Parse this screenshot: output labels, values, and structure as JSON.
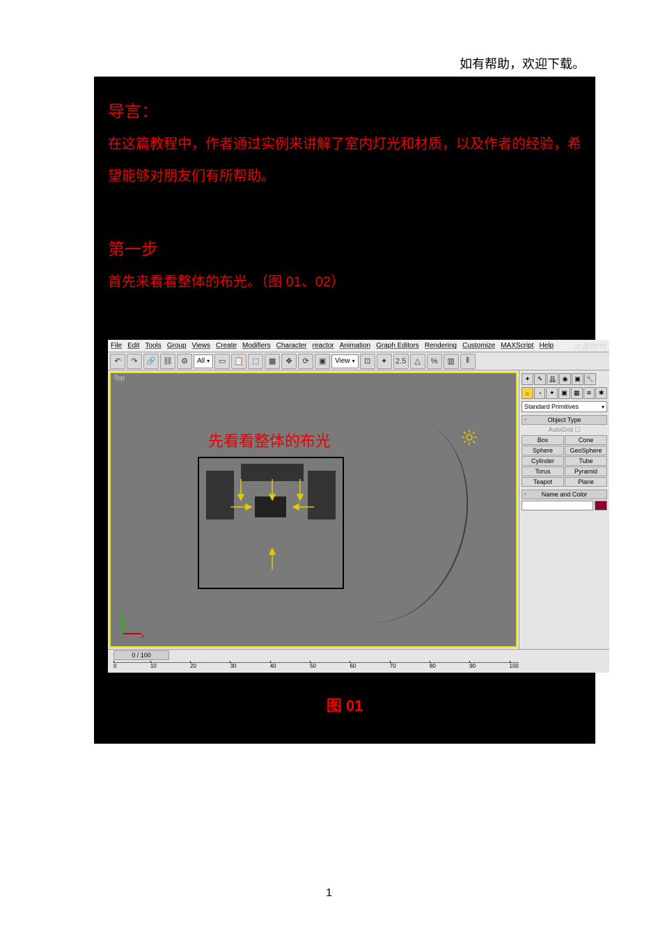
{
  "header": {
    "help_note": "如有帮助，欢迎下载。"
  },
  "article": {
    "intro_label": "导言：",
    "intro_body": "在这篇教程中，作者通过实例来讲解了室内灯光和材质，以及作者的经验，希望能够对朋友们有所帮助。",
    "step1_label": "第一步",
    "step1_body": "首先来看看整体的布光。（图 01、02）",
    "figure_caption": "图 01"
  },
  "screenshot": {
    "menubar": [
      "File",
      "Edit",
      "Tools",
      "Group",
      "Views",
      "Create",
      "Modifiers",
      "Character",
      "reactor",
      "Animation",
      "Graph Editors",
      "Rendering",
      "Customize",
      "MAXScript",
      "Help"
    ],
    "toolbar": {
      "all_label": "All",
      "view_label": "View"
    },
    "viewport": {
      "label": "Top",
      "annotation": "先看看整体的布光"
    },
    "side_panel": {
      "dropdown_selected": "Standard Primitives",
      "object_type_header": "Object Type",
      "autogrid": "AutoGrid",
      "buttons": [
        "Box",
        "Cone",
        "Sphere",
        "GeoSphere",
        "Cylinder",
        "Tube",
        "Torus",
        "Pyramid",
        "Teapot",
        "Plane"
      ],
      "name_header": "Name and Color"
    },
    "timeline": {
      "current": "0 / 100",
      "ticks": [
        "0",
        "10",
        "20",
        "30",
        "40",
        "50",
        "60",
        "70",
        "80",
        "90",
        "100"
      ]
    },
    "watermark": "火星时代"
  },
  "page_number": "1"
}
